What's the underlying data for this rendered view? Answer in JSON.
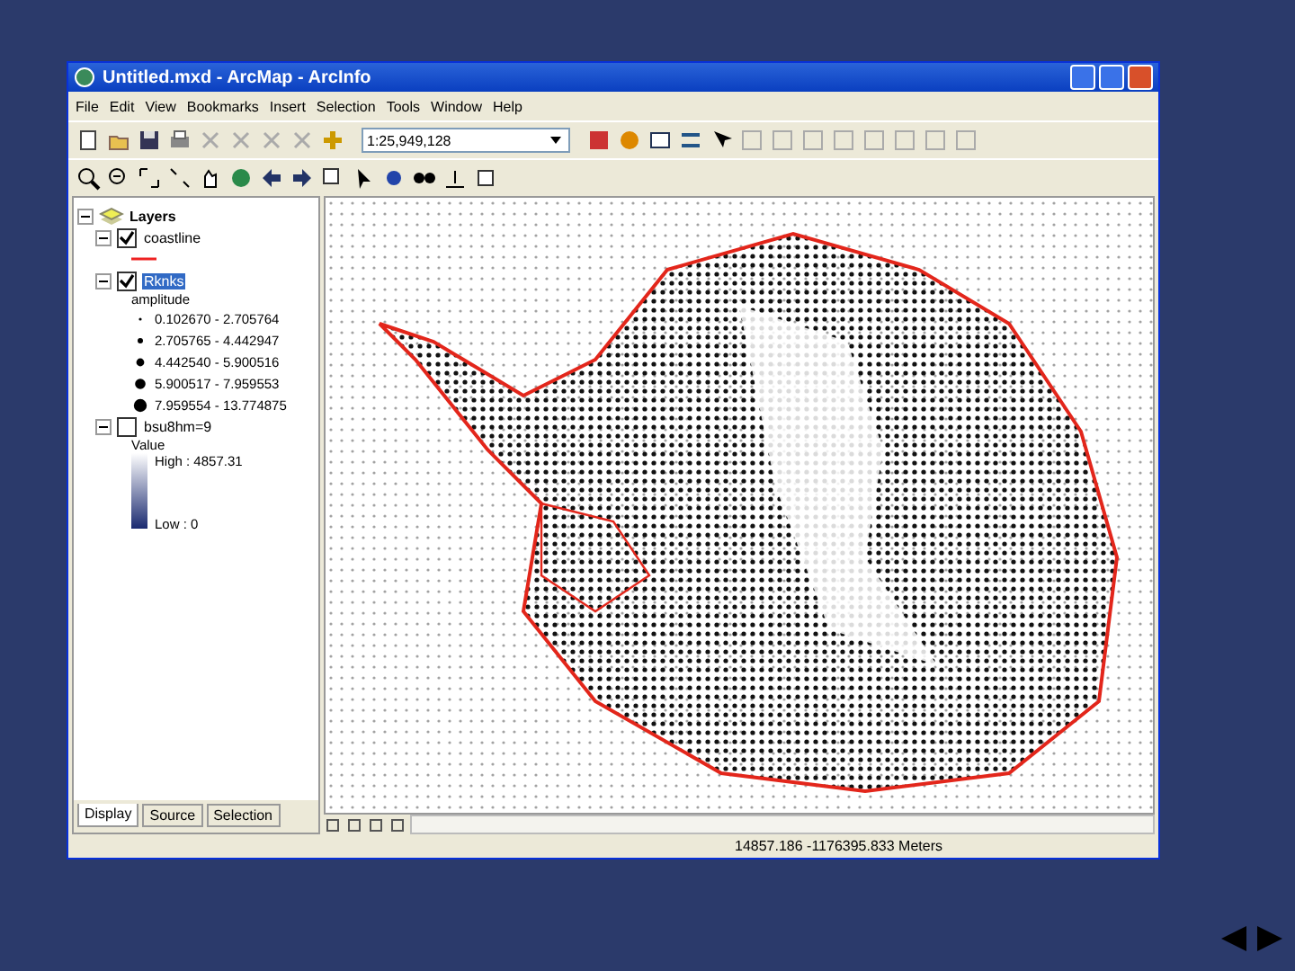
{
  "window": {
    "title": "Untitled.mxd - ArcMap - ArcInfo"
  },
  "menu": [
    "File",
    "Edit",
    "View",
    "Bookmarks",
    "Insert",
    "Selection",
    "Tools",
    "Window",
    "Help"
  ],
  "toolbar": {
    "scale": "1:25,949,128"
  },
  "toc": {
    "root": {
      "label": "Layers",
      "expanded": true
    },
    "layers": [
      {
        "label": "coastline",
        "checked": true,
        "expanded": true,
        "selected": false,
        "kind": "line"
      },
      {
        "label": "Rknks",
        "checked": true,
        "expanded": true,
        "selected": true,
        "kind": "points",
        "legend_title": "amplitude",
        "entries": [
          "0.102670 - 2.705764",
          "2.705765 - 4.442947",
          "4.442540 - 5.900516",
          "5.900517 - 7.959553",
          "7.959554 - 13.774875"
        ]
      },
      {
        "label": "bsu8hm=9",
        "checked": false,
        "expanded": true,
        "selected": false,
        "kind": "ramp",
        "legend_title": "Value",
        "entries": [
          "High : 4857.31",
          "Low : 0"
        ]
      }
    ]
  },
  "tabs": [
    {
      "label": "Display",
      "selected": true
    },
    {
      "label": "Source",
      "selected": false
    },
    {
      "label": "Selection",
      "selected": false
    }
  ],
  "status_bar": {
    "coordinates": "14857.186 -1176395.833 Meters"
  }
}
